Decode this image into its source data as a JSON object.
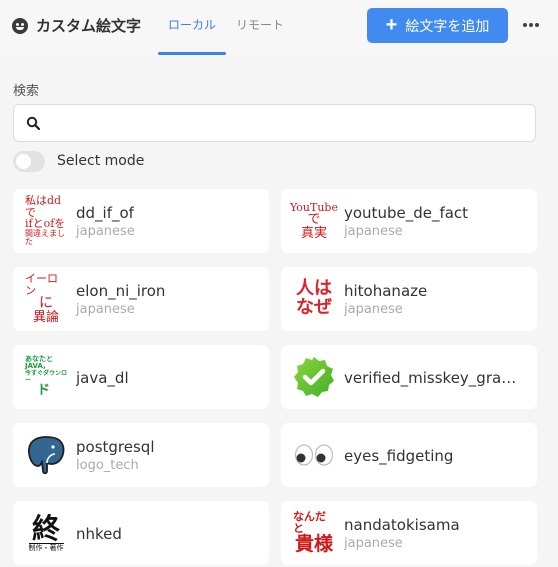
{
  "header": {
    "title": "カスタム絵文字",
    "tabs": [
      {
        "label": "ローカル",
        "active": true
      },
      {
        "label": "リモート",
        "active": false
      }
    ],
    "add_button_label": "絵文字を追加",
    "accent_color": "#418bf0"
  },
  "search": {
    "label": "検索",
    "value": "",
    "placeholder": ""
  },
  "select_mode": {
    "label": "Select mode",
    "enabled": false
  },
  "emojis": [
    {
      "name": "dd_if_of",
      "category": "japanese",
      "glyph": [
        "私はddで",
        "ifとofを",
        "間違えました"
      ]
    },
    {
      "name": "youtube_de_fact",
      "category": "japanese",
      "glyph": [
        "YouTube",
        "で",
        "真実"
      ]
    },
    {
      "name": "elon_ni_iron",
      "category": "japanese",
      "glyph": [
        "イーロン",
        "に",
        "異論"
      ]
    },
    {
      "name": "hitohanaze",
      "category": "japanese",
      "glyph": [
        "人は",
        "なぜ"
      ]
    },
    {
      "name": "java_dl",
      "category": "",
      "glyph": [
        "あなたとJAVA,",
        "今すぐダウンロー",
        "ド"
      ]
    },
    {
      "name": "verified_misskey_gradient",
      "category": "",
      "glyph": []
    },
    {
      "name": "postgresql",
      "category": "logo_tech",
      "glyph": []
    },
    {
      "name": "eyes_fidgeting",
      "category": "",
      "glyph": []
    },
    {
      "name": "nhked",
      "category": "",
      "glyph": [
        "終",
        "制作・著作"
      ]
    },
    {
      "name": "nandatokisama",
      "category": "japanese",
      "glyph": [
        "なんだと",
        "貴様"
      ]
    }
  ]
}
